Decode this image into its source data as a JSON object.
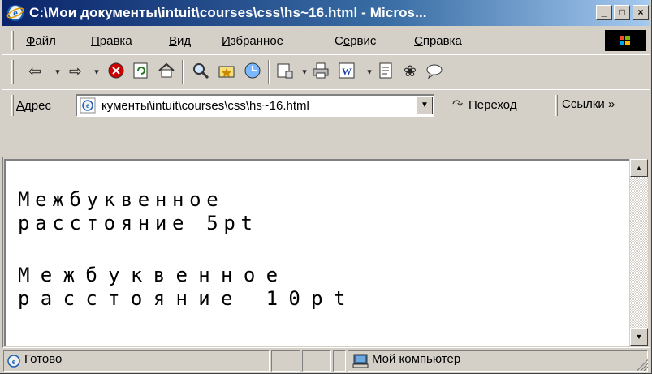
{
  "window": {
    "title": "C:\\Мои документы\\intuit\\courses\\css\\hs~16.html - Micros...",
    "controls": {
      "minimize": "_",
      "maximize": "□",
      "close": "×"
    }
  },
  "menu": {
    "items": [
      {
        "label": "Файл",
        "accel": "Ф",
        "rest": "айл"
      },
      {
        "label": "Правка",
        "accel": "П",
        "rest": "равка"
      },
      {
        "label": "Вид",
        "accel": "В",
        "rest": "ид"
      },
      {
        "label": "Избранное",
        "accel": "И",
        "rest": "збранное"
      },
      {
        "label": "Сервис",
        "pre": "С",
        "accel": "е",
        "rest": "рвис"
      },
      {
        "label": "Справка",
        "accel": "С",
        "rest": "правка"
      }
    ]
  },
  "toolbar": {
    "icons": [
      "back-icon",
      "forward-icon",
      "stop-icon",
      "refresh-icon",
      "home-icon",
      "search-icon",
      "favorites-icon",
      "history-icon",
      "mail-icon",
      "print-icon",
      "edit-icon",
      "discuss-icon",
      "messenger-icon",
      "messenger2-icon"
    ]
  },
  "address": {
    "label_accel": "А",
    "label_rest": "дрес",
    "url": "кументы\\intuit\\courses\\css\\hs~16.html",
    "go_label": "Переход",
    "links_label": "Ссылки »"
  },
  "content": {
    "para1": "Межбуквенное\nрасстояние 5pt",
    "para2": "Межбуквенное\nрасстояние 10pt"
  },
  "status": {
    "text": "Готово",
    "zone": "Мой компьютер"
  }
}
